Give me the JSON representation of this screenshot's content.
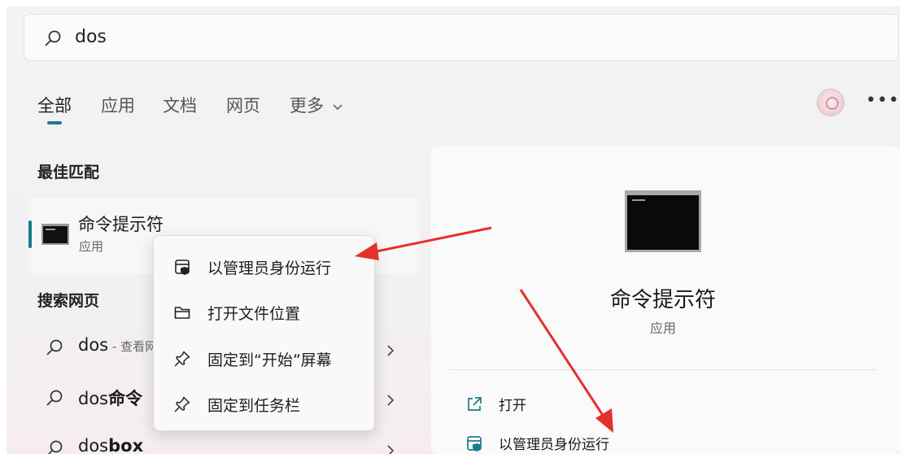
{
  "search": {
    "query": "dos"
  },
  "tabs": [
    {
      "label": "全部"
    },
    {
      "label": "应用"
    },
    {
      "label": "文档"
    },
    {
      "label": "网页"
    },
    {
      "label": "更多"
    }
  ],
  "best_match": {
    "heading": "最佳匹配",
    "title": "命令提示符",
    "subtitle": "应用"
  },
  "web_search": {
    "heading": "搜索网页",
    "items": [
      {
        "prefix": "dos",
        "bold": "",
        "hint": " - 查看",
        "hint2": "网"
      },
      {
        "prefix": "dos",
        "bold": "命令",
        "hint": "",
        "hint2": ""
      },
      {
        "prefix": "dos",
        "bold": "box",
        "hint": "",
        "hint2": ""
      }
    ]
  },
  "context_menu": {
    "items": [
      {
        "label": "以管理员身份运行",
        "icon": "shield-icon"
      },
      {
        "label": "打开文件位置",
        "icon": "folder-icon"
      },
      {
        "label": "固定到“开始”屏幕",
        "icon": "pin-icon"
      },
      {
        "label": "固定到任务栏",
        "icon": "pin-icon"
      }
    ]
  },
  "details": {
    "title": "命令提示符",
    "subtitle": "应用",
    "actions": [
      {
        "label": "打开",
        "icon": "open-external-icon"
      },
      {
        "label": "以管理员身份运行",
        "icon": "shield-icon"
      }
    ]
  },
  "colors": {
    "accent": "#1b7a8c",
    "annotation_arrow": "#e4312b"
  }
}
